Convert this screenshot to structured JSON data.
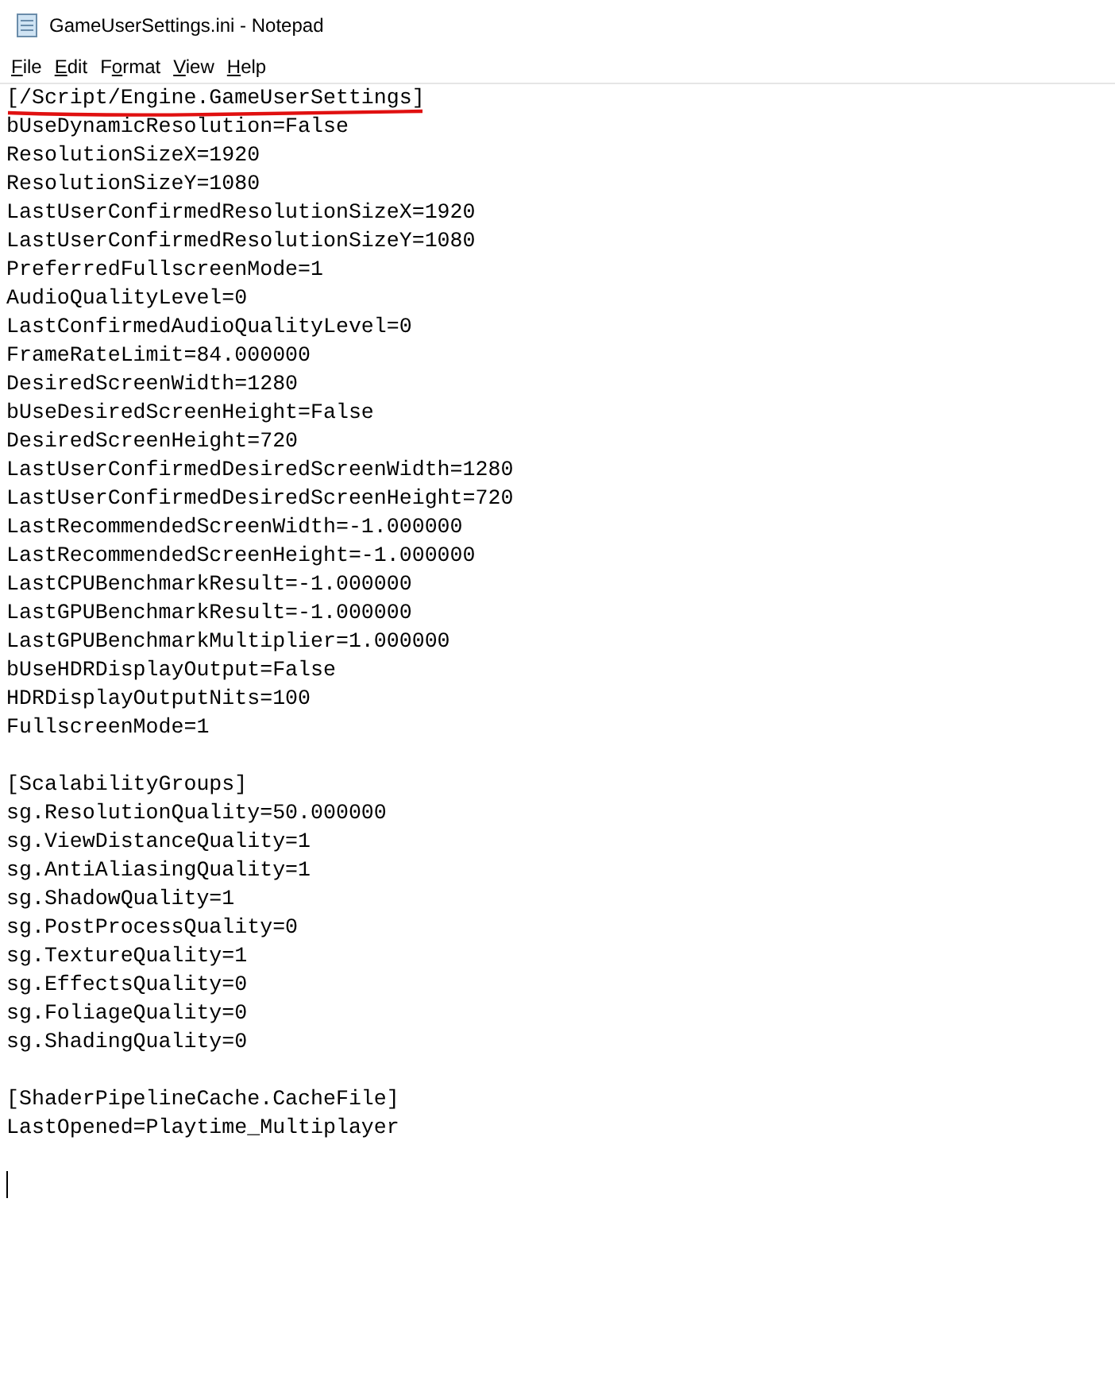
{
  "window": {
    "title": "GameUserSettings.ini - Notepad"
  },
  "menu": [
    {
      "key": "F",
      "after": "ile"
    },
    {
      "key": "E",
      "after": "dit"
    },
    {
      "before": "F",
      "key": "o",
      "after": "rmat"
    },
    {
      "key": "V",
      "after": "iew"
    },
    {
      "key": "H",
      "after": "elp"
    }
  ],
  "sections": [
    {
      "header": "[/Script/Engine.GameUserSettings]",
      "annotated": true,
      "lines": [
        "bUseDynamicResolution=False",
        "ResolutionSizeX=1920",
        "ResolutionSizeY=1080",
        "LastUserConfirmedResolutionSizeX=1920",
        "LastUserConfirmedResolutionSizeY=1080",
        "PreferredFullscreenMode=1",
        "AudioQualityLevel=0",
        "LastConfirmedAudioQualityLevel=0",
        "FrameRateLimit=84.000000",
        "DesiredScreenWidth=1280",
        "bUseDesiredScreenHeight=False",
        "DesiredScreenHeight=720",
        "LastUserConfirmedDesiredScreenWidth=1280",
        "LastUserConfirmedDesiredScreenHeight=720",
        "LastRecommendedScreenWidth=-1.000000",
        "LastRecommendedScreenHeight=-1.000000",
        "LastCPUBenchmarkResult=-1.000000",
        "LastGPUBenchmarkResult=-1.000000",
        "LastGPUBenchmarkMultiplier=1.000000",
        "bUseHDRDisplayOutput=False",
        "HDRDisplayOutputNits=100",
        "FullscreenMode=1"
      ]
    },
    {
      "header": "[ScalabilityGroups]",
      "annotated": false,
      "lines": [
        "sg.ResolutionQuality=50.000000",
        "sg.ViewDistanceQuality=1",
        "sg.AntiAliasingQuality=1",
        "sg.ShadowQuality=1",
        "sg.PostProcessQuality=0",
        "sg.TextureQuality=1",
        "sg.EffectsQuality=0",
        "sg.FoliageQuality=0",
        "sg.ShadingQuality=0"
      ]
    },
    {
      "header": "[ShaderPipelineCache.CacheFile]",
      "annotated": false,
      "lines": [
        "LastOpened=Playtime_Multiplayer"
      ]
    }
  ]
}
